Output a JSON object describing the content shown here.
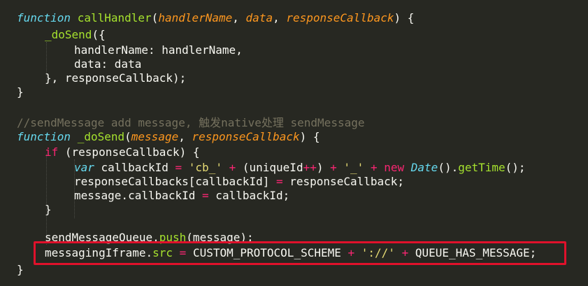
{
  "code": {
    "line1": {
      "kw": "function",
      "name": "callHandler",
      "p1": "handlerName",
      "p2": "data",
      "p3": "responseCallback",
      "tail": ") {"
    },
    "line2": {
      "fn": "_doSend",
      "tail": "({"
    },
    "line3": {
      "text": "handlerName: handlerName,"
    },
    "line4": {
      "text": "data: data"
    },
    "line5": {
      "text": "}, responseCallback);"
    },
    "line6": {
      "text": "}"
    },
    "line8": {
      "comment": "//sendMessage add message, 触发native处理 sendMessage"
    },
    "line9": {
      "kw": "function",
      "name": "_doSend",
      "p1": "message",
      "p2": "responseCallback",
      "tail": ") {"
    },
    "line10": {
      "kw": "if",
      "text": " (responseCallback) {"
    },
    "line11": {
      "kw": "var",
      "var": " callbackId ",
      "eq": "=",
      "str1": "'cb_'",
      "plus": "+",
      "mid": "(uniqueId",
      "inc": "++",
      "close": ")",
      "str2": "'_'",
      "new": "new",
      "type": "Date",
      "paren": "().",
      "getTime": "getTime",
      "end": "();"
    },
    "line12": {
      "lhs": "responseCallbacks[callbackId] ",
      "eq": "=",
      "rhs": " responseCallback;"
    },
    "line13": {
      "lhs": "message.callbackId ",
      "eq": "=",
      "rhs": " callbackId;"
    },
    "line14": {
      "text": "}"
    },
    "line16": {
      "obj": "sendMessageQueue.",
      "method": "push",
      "args": "(message);"
    },
    "line17": {
      "obj": "messagingIframe.",
      "prop": "src",
      "eq": "=",
      "const1": " CUSTOM_PROTOCOL_SCHEME ",
      "plus": "+",
      "str": "'://'",
      "const2": " QUEUE_HAS_MESSAGE;"
    },
    "line18": {
      "text": "}"
    }
  }
}
